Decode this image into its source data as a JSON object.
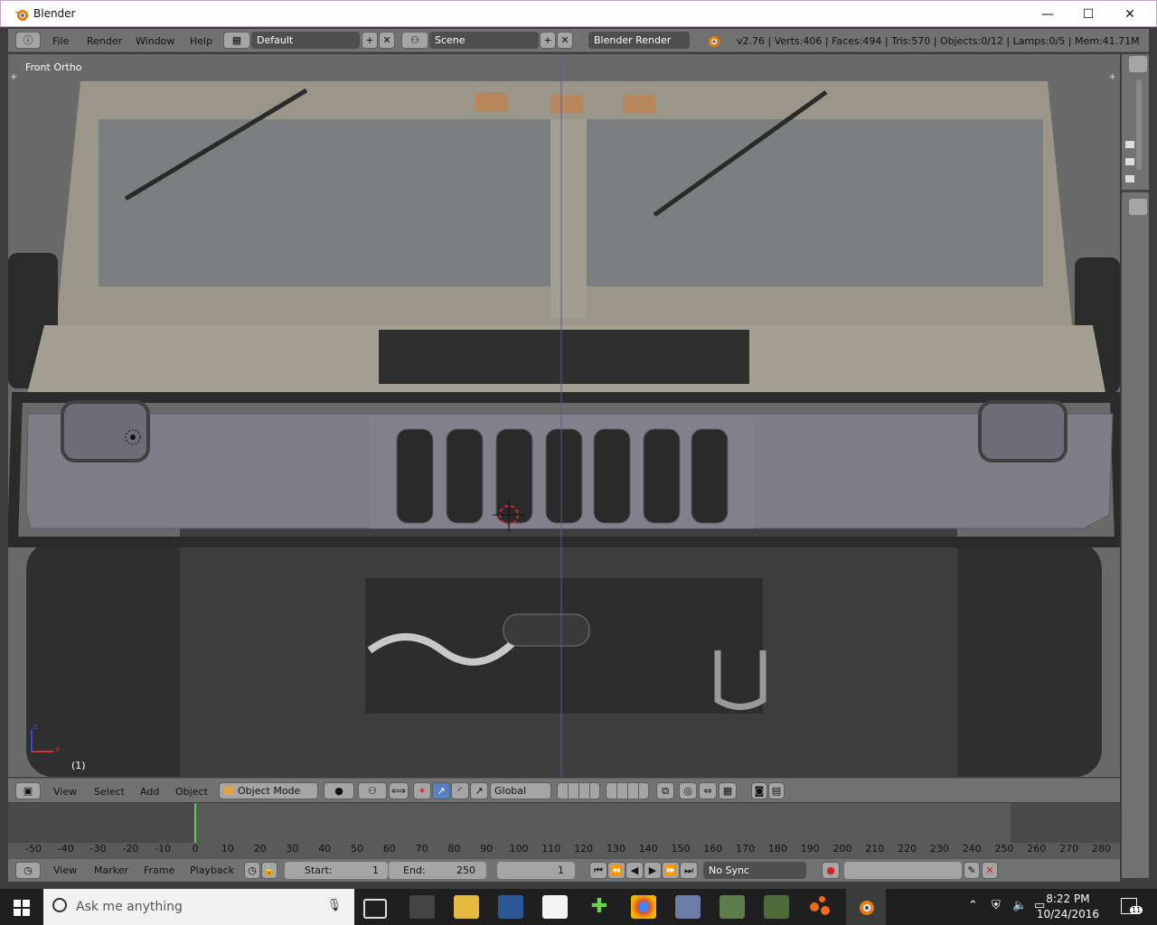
{
  "window": {
    "title": "Blender",
    "minimize": "—",
    "maximize": "☐",
    "close": "✕"
  },
  "info_header": {
    "menus": [
      "File",
      "Render",
      "Window",
      "Help"
    ],
    "screen_layout": "Default",
    "scene": "Scene",
    "render_engine": "Blender Render",
    "stats": "v2.76 | Verts:406 | Faces:494 | Tris:570 | Objects:0/12 | Lamps:0/5 | Mem:41.71M"
  },
  "viewport": {
    "view_label": "Front Ortho",
    "frame_label": "(1)"
  },
  "view3d_header": {
    "menus": [
      "View",
      "Select",
      "Add",
      "Object"
    ],
    "mode": "Object Mode",
    "orientation": "Global"
  },
  "timeline": {
    "ticks": [
      "-50",
      "-40",
      "-30",
      "-20",
      "-10",
      "0",
      "10",
      "20",
      "30",
      "40",
      "50",
      "60",
      "70",
      "80",
      "90",
      "100",
      "110",
      "120",
      "130",
      "140",
      "150",
      "160",
      "170",
      "180",
      "190",
      "200",
      "210",
      "220",
      "230",
      "240",
      "250",
      "260",
      "270",
      "280"
    ],
    "current_frame_marker": 0
  },
  "timeline_header": {
    "menus": [
      "View",
      "Marker",
      "Frame",
      "Playback"
    ],
    "start_label": "Start:",
    "start_value": "1",
    "end_label": "End:",
    "end_value": "250",
    "current_frame": "1",
    "sync": "No Sync"
  },
  "taskbar": {
    "search_placeholder": "Ask me anything",
    "time": "8:22 PM",
    "date": "10/24/2016",
    "notifications": "11"
  },
  "colors": {
    "viewport_bg": "#6b6b6b",
    "panel": "#727272",
    "accent_blue": "#5680c2"
  }
}
